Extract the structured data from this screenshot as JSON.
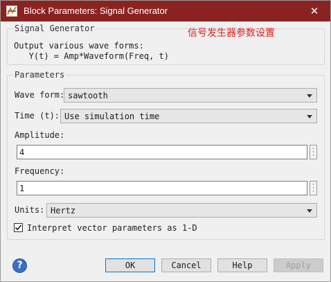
{
  "window": {
    "title": "Block Parameters: Signal Generator",
    "close_glyph": "✕",
    "titlebar_color": "#8b2222"
  },
  "annotation": {
    "text": "信号发生器参数设置",
    "color": "#e02020"
  },
  "description_group": {
    "legend": "Signal Generator",
    "lines": [
      "Output various wave forms:",
      "   Y(t) = Amp*Waveform(Freq, t)"
    ]
  },
  "parameters": {
    "legend": "Parameters",
    "wave_form": {
      "label": "Wave form:",
      "value": "sawtooth"
    },
    "time": {
      "label": "Time (t):",
      "value": "Use simulation time"
    },
    "amplitude": {
      "label": "Amplitude:",
      "value": "4"
    },
    "frequency": {
      "label": "Frequency:",
      "value": "1"
    },
    "units": {
      "label": "Units:",
      "value": "Hertz"
    },
    "interpret": {
      "label": "Interpret vector parameters as 1-D",
      "checked": true
    }
  },
  "buttons": {
    "ok": "OK",
    "cancel": "Cancel",
    "help": "Help",
    "apply": "Apply"
  },
  "icons": {
    "app": "simulink-block-icon",
    "help": "help-question-icon",
    "close": "close-icon",
    "dropdown": "dropdown-arrow-icon",
    "more": "more-dots-icon",
    "check": "checkmark-icon"
  }
}
